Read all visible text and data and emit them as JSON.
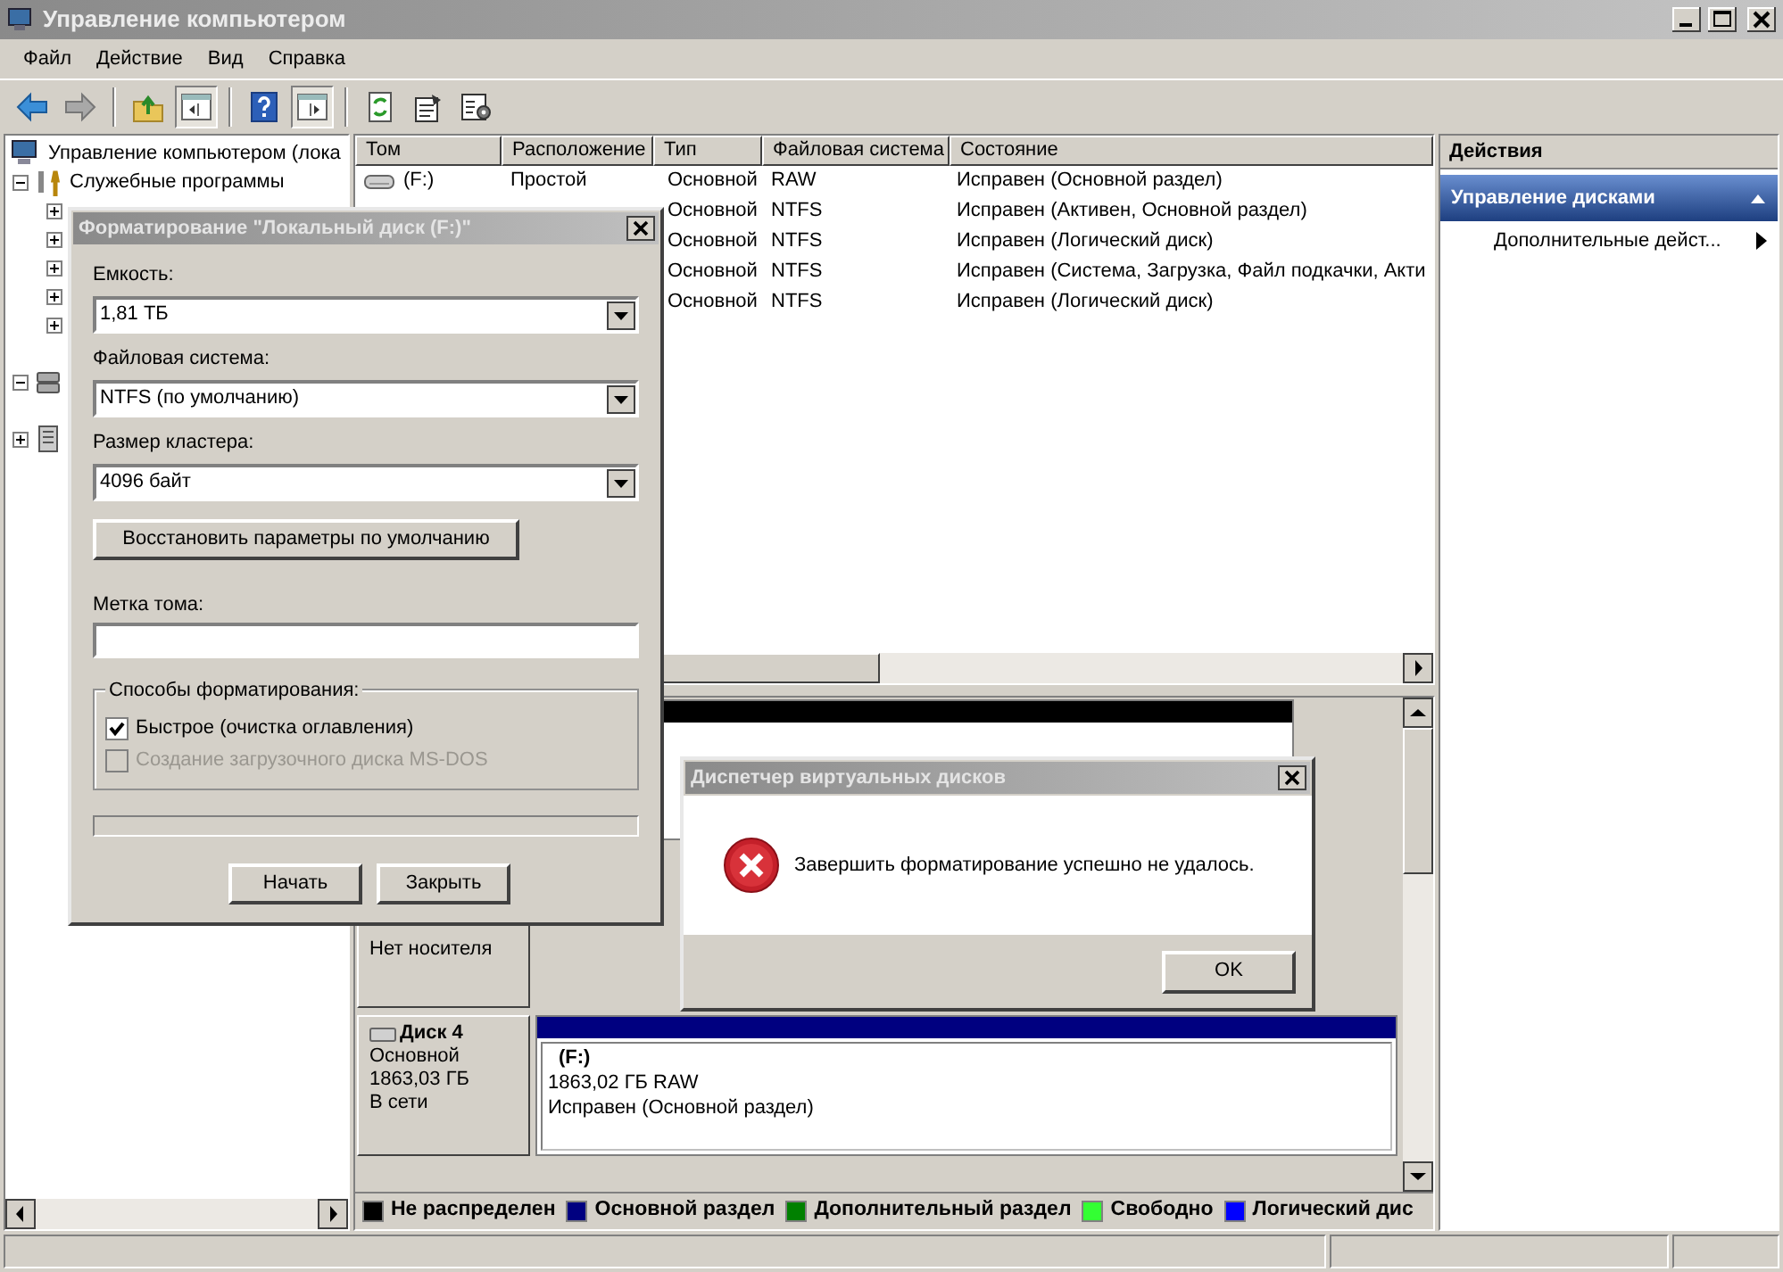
{
  "window": {
    "title": "Управление компьютером"
  },
  "menu": [
    "Файл",
    "Действие",
    "Вид",
    "Справка"
  ],
  "toolbar": [
    {
      "kind": "back",
      "pressed": false
    },
    {
      "kind": "forward",
      "pressed": false
    },
    {
      "kind": "separator"
    },
    {
      "kind": "up",
      "pressed": false
    },
    {
      "kind": "tree",
      "pressed": true
    },
    {
      "kind": "separator"
    },
    {
      "kind": "help",
      "pressed": false
    },
    {
      "kind": "pane",
      "pressed": true
    },
    {
      "kind": "separator"
    },
    {
      "kind": "refresh",
      "pressed": false
    },
    {
      "kind": "properties",
      "pressed": false
    },
    {
      "kind": "settings",
      "pressed": false
    }
  ],
  "tree": {
    "label": "Управление компьютером (лока",
    "children": [
      {
        "label": "Служебные программы",
        "kind": "tools",
        "expanded": true,
        "children": [
          {
            "expanded": false
          },
          {
            "expanded": false
          },
          {
            "expanded": false
          },
          {
            "expanded": false
          },
          {
            "expanded": false
          }
        ]
      },
      {
        "kind": "storage",
        "expanded": true
      },
      {
        "kind": "services",
        "expanded": false
      }
    ]
  },
  "volume_list": {
    "columns": [
      "Том",
      "Расположение",
      "Тип",
      "Файловая система",
      "Состояние"
    ],
    "rows": [
      {
        "volume": "(F:)",
        "layout": "Простой",
        "type": "Основной",
        "file_system": "RAW",
        "status": "Исправен (Основной раздел)"
      },
      {
        "type": "Основной",
        "file_system": "NTFS",
        "status": "Исправен (Активен, Основной раздел)"
      },
      {
        "type": "Основной",
        "file_system": "NTFS",
        "status": "Исправен (Логический диск)"
      },
      {
        "type": "Основной",
        "file_system": "NTFS",
        "status": "Исправен (Система, Загрузка, Файл подкачки, Акти"
      },
      {
        "type": "Основной",
        "file_system": "NTFS",
        "status": "Исправен (Логический диск)"
      }
    ]
  },
  "disk_view": {
    "disks": [
      {
        "kind": "partial",
        "partitions": [
          {
            "color": "#000000"
          }
        ]
      },
      {
        "kind": "removable",
        "lines": [
          "Нет носителя"
        ]
      },
      {
        "kind": "disk",
        "name": "Диск 4",
        "lines": [
          "Основной",
          "1863,03 ГБ",
          "В сети"
        ],
        "partitions": [
          {
            "color": "#000080",
            "name": "(F:)",
            "size": "1863,02 ГБ RAW",
            "status": "Исправен (Основной раздел)"
          }
        ]
      }
    ],
    "legend": [
      {
        "label": "Не распределен",
        "color": "#000000"
      },
      {
        "label": "Основной раздел",
        "color": "#000080"
      },
      {
        "label": "Дополнительный раздел",
        "color": "#008000"
      },
      {
        "label": "Свободно",
        "color": "#33ff33"
      },
      {
        "label": "Логический дис",
        "color": "#0000ff"
      }
    ]
  },
  "actions": {
    "title": "Действия",
    "section": {
      "label": "Управление дисками",
      "expanded": true
    },
    "items": [
      "Дополнительные дейст..."
    ]
  },
  "format_dialog": {
    "title": "Форматирование \"Локальный диск (F:)\"",
    "fields": [
      {
        "label": "Емкость:",
        "value": "1,81 ТБ"
      },
      {
        "label": "Файловая система:",
        "value": "NTFS (по умолчанию)"
      },
      {
        "label": "Размер кластера:",
        "value": "4096 байт"
      }
    ],
    "restore_button": "Восстановить параметры по умолчанию",
    "volume_label": {
      "label": "Метка тома:"
    },
    "options": {
      "title": "Способы форматирования:",
      "items": [
        {
          "label": "Быстрое (очистка оглавления)",
          "checked": true,
          "disabled": false
        },
        {
          "label": "Создание загрузочного диска MS-DOS",
          "checked": false,
          "disabled": true
        }
      ]
    },
    "progress": {
      "level": 0
    },
    "buttons": [
      "Начать",
      "Закрыть"
    ]
  },
  "error_dialog": {
    "title": "Диспетчер виртуальных дисков",
    "message": "Завершить форматирование успешно не удалось.",
    "button": "OK"
  }
}
